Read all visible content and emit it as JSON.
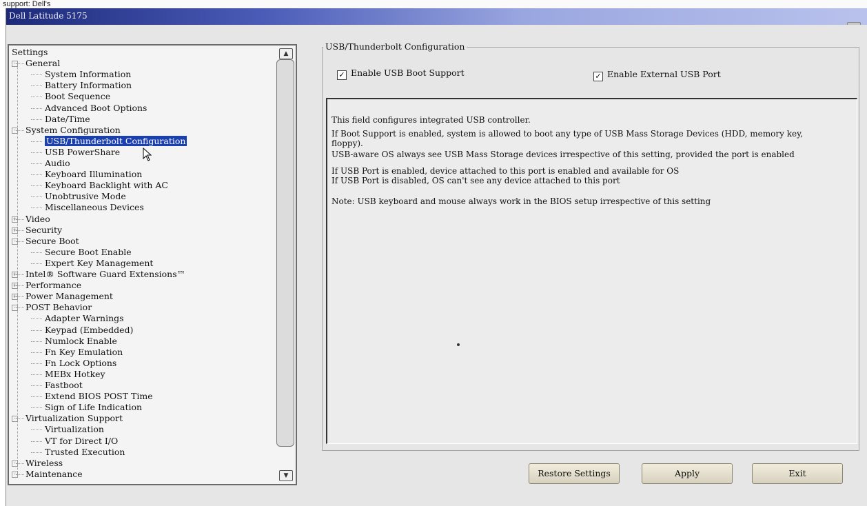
{
  "window": {
    "top_strip_text": "support: Dell's",
    "title": "Dell Latitude 5175",
    "close_glyph": "×"
  },
  "tree": {
    "items": [
      {
        "label": "Settings"
      },
      {
        "label": "General"
      },
      {
        "label": "System Information"
      },
      {
        "label": "Battery Information"
      },
      {
        "label": "Boot Sequence"
      },
      {
        "label": "Advanced Boot Options"
      },
      {
        "label": "Date/Time"
      },
      {
        "label": "System Configuration"
      },
      {
        "label": "USB/Thunderbolt Configuration",
        "selected": true
      },
      {
        "label": "USB PowerShare"
      },
      {
        "label": "Audio"
      },
      {
        "label": "Keyboard Illumination"
      },
      {
        "label": "Keyboard Backlight with AC"
      },
      {
        "label": "Unobtrusive Mode"
      },
      {
        "label": "Miscellaneous Devices"
      },
      {
        "label": "Video"
      },
      {
        "label": "Security"
      },
      {
        "label": "Secure Boot"
      },
      {
        "label": "Secure Boot Enable"
      },
      {
        "label": "Expert Key Management"
      },
      {
        "label": "Intel® Software Guard Extensions™"
      },
      {
        "label": "Performance"
      },
      {
        "label": "Power Management"
      },
      {
        "label": "POST Behavior"
      },
      {
        "label": "Adapter Warnings"
      },
      {
        "label": "Keypad (Embedded)"
      },
      {
        "label": "Numlock Enable"
      },
      {
        "label": "Fn Key Emulation"
      },
      {
        "label": "Fn Lock Options"
      },
      {
        "label": "MEBx Hotkey"
      },
      {
        "label": "Fastboot"
      },
      {
        "label": "Extend BIOS POST Time"
      },
      {
        "label": "Sign of Life Indication"
      },
      {
        "label": "Virtualization Support"
      },
      {
        "label": "Virtualization"
      },
      {
        "label": "VT for Direct I/O"
      },
      {
        "label": "Trusted Execution"
      },
      {
        "label": "Wireless"
      },
      {
        "label": "Maintenance"
      }
    ],
    "scroll_up_glyph": "▲",
    "scroll_down_glyph": "▼"
  },
  "config": {
    "group_title": "USB/Thunderbolt Configuration",
    "checkbox_boot": {
      "label": "Enable USB Boot Support",
      "checked": true
    },
    "checkbox_port": {
      "label": "Enable External USB Port",
      "checked": true
    },
    "check_glyph": "✓",
    "description": [
      "This field configures integrated USB controller.",
      "If Boot Support is enabled, system is allowed to boot any type of USB Mass Storage Devices (HDD, memory key,",
      "floppy).",
      "USB-aware OS always see USB Mass Storage devices irrespective of this setting, provided the port is enabled",
      "If USB Port is enabled, device attached to this port is enabled and available for OS",
      "If USB Port is disabled, OS can't see any device attached to this port",
      "Note: USB keyboard and mouse always work in the BIOS setup irrespective of this setting"
    ]
  },
  "buttons": {
    "restore": "Restore Settings",
    "apply": "Apply",
    "exit": "Exit"
  },
  "colors": {
    "selection": "#1a3fae",
    "titlebar_start": "#1d2a7a"
  }
}
